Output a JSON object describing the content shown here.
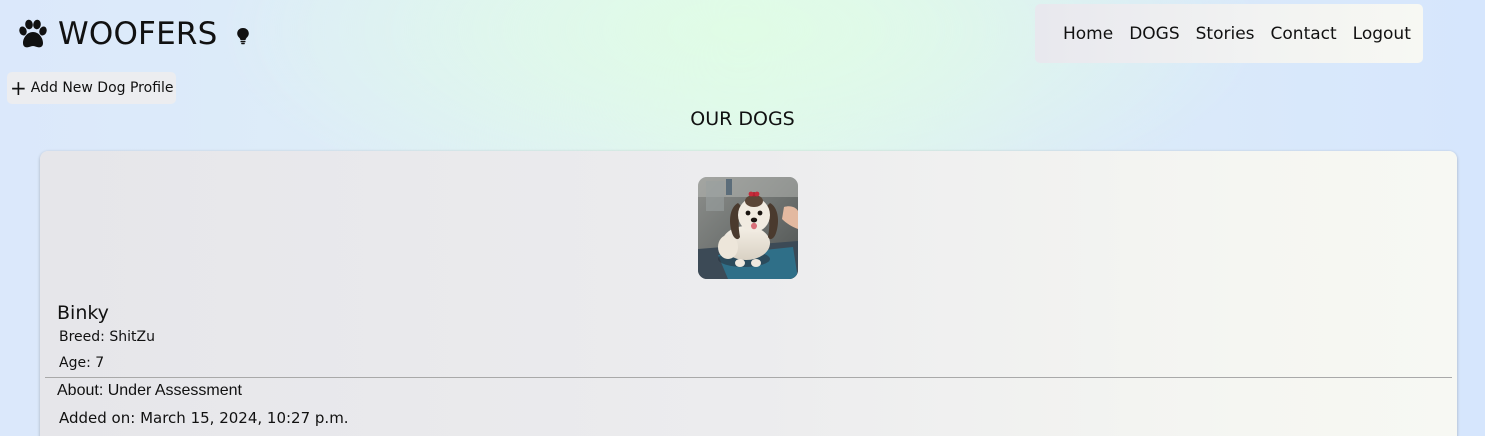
{
  "brand": {
    "title": "WOOFERS",
    "logo_icon": "paw-icon",
    "theme_icon": "lightbulb-icon"
  },
  "nav": {
    "items": [
      {
        "label": "Home"
      },
      {
        "label": "DOGS"
      },
      {
        "label": "Stories"
      },
      {
        "label": "Contact"
      },
      {
        "label": "Logout"
      }
    ]
  },
  "toolbar": {
    "add_icon": "plus-icon",
    "add_label": "Add New Dog Profile"
  },
  "page": {
    "title": "OUR DOGS"
  },
  "dogs": [
    {
      "name": "Binky",
      "breed_label": "Breed:",
      "breed": "ShitZu",
      "age_label": "Age:",
      "age": "7",
      "about_label": "About:",
      "about": "Under Assessment",
      "added_label": "Added on:",
      "added_on": "March 15, 2024, 10:27 p.m."
    }
  ],
  "colors": {
    "card_bg": "#ececee",
    "nav_bg": "#f0f1f0",
    "page_bg_left": "#dbe8fb",
    "page_bg_center": "#e0fce6"
  }
}
